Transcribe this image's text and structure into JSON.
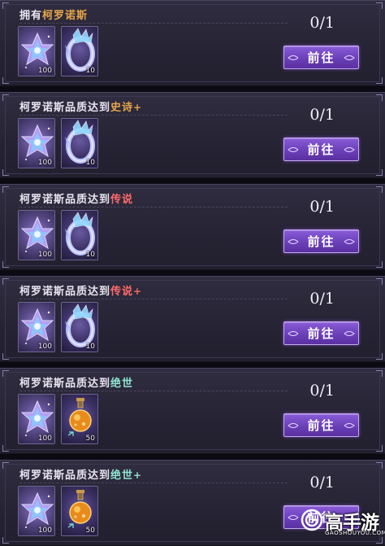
{
  "quests": [
    {
      "title_prefix": "拥有",
      "title_highlight": "柯罗诺斯",
      "title_suffix": "",
      "highlight_color": "#e6a548",
      "progress": "0/1",
      "button_label": "前往",
      "rewards": [
        {
          "icon": "star-crystal-icon",
          "qty": "100"
        },
        {
          "icon": "crystal-ring-icon",
          "qty": "10"
        }
      ]
    },
    {
      "title_prefix": "柯罗诺斯品质达到",
      "title_highlight": "史诗",
      "title_suffix": "+",
      "highlight_color": "#e6a548",
      "progress": "0/1",
      "button_label": "前往",
      "rewards": [
        {
          "icon": "star-crystal-icon",
          "qty": "100"
        },
        {
          "icon": "crystal-ring-icon",
          "qty": "10"
        }
      ]
    },
    {
      "title_prefix": "柯罗诺斯品质达到",
      "title_highlight": "传说",
      "title_suffix": "",
      "highlight_color": "#ff6a6a",
      "progress": "0/1",
      "button_label": "前往",
      "rewards": [
        {
          "icon": "star-crystal-icon",
          "qty": "100"
        },
        {
          "icon": "crystal-ring-icon",
          "qty": "10"
        }
      ]
    },
    {
      "title_prefix": "柯罗诺斯品质达到",
      "title_highlight": "传说",
      "title_suffix": "+",
      "highlight_color": "#ff6a6a",
      "progress": "0/1",
      "button_label": "前往",
      "rewards": [
        {
          "icon": "star-crystal-icon",
          "qty": "100"
        },
        {
          "icon": "crystal-ring-icon",
          "qty": "10"
        }
      ]
    },
    {
      "title_prefix": "柯罗诺斯品质达到",
      "title_highlight": "绝世",
      "title_suffix": "",
      "highlight_color": "#8fe3d0",
      "progress": "0/1",
      "button_label": "前往",
      "rewards": [
        {
          "icon": "star-crystal-icon",
          "qty": "100"
        },
        {
          "icon": "potion-flask-icon",
          "qty": "50"
        }
      ]
    },
    {
      "title_prefix": "柯罗诺斯品质达到",
      "title_highlight": "绝世",
      "title_suffix": "+",
      "highlight_color": "#8fe3d0",
      "progress": "0/1",
      "button_label": "前往",
      "rewards": [
        {
          "icon": "star-crystal-icon",
          "qty": "100"
        },
        {
          "icon": "potion-flask-icon",
          "qty": "50"
        }
      ]
    }
  ],
  "watermark": {
    "name": "高手游",
    "url": "GAOSHOUYOU.COM"
  }
}
